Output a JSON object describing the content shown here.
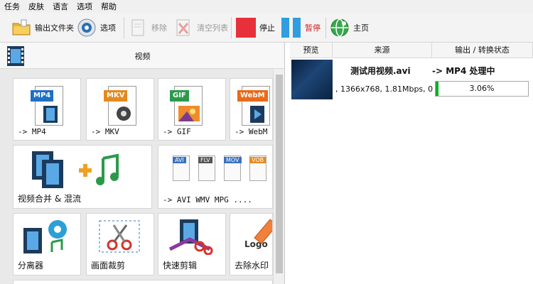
{
  "menu": [
    "任务",
    "皮肤",
    "语言",
    "选项",
    "帮助"
  ],
  "toolbar": {
    "output_folder": "输出文件夹",
    "options": "选项",
    "remove": "移除",
    "clear_list": "清空列表",
    "stop": "停止",
    "pause": "暂停",
    "home": "主页"
  },
  "category": {
    "label": "视频"
  },
  "tiles": {
    "mp4": {
      "tag": "MP4",
      "label": "-> MP4"
    },
    "mkv": {
      "tag": "MKV",
      "label": "-> MKV"
    },
    "gif": {
      "tag": "GIF",
      "label": "-> GIF"
    },
    "webm": {
      "tag": "WebM",
      "label": "-> WebM"
    },
    "merge": {
      "label": "视频合并 & 混流"
    },
    "multi": {
      "tags": [
        "AVI",
        "FLV",
        "MOV",
        "VOB"
      ],
      "label": "-> AVI WMV MPG ...."
    },
    "splitter": {
      "label": "分离器"
    },
    "crop": {
      "label": "画面裁剪"
    },
    "quickcut": {
      "label": "快速剪辑"
    },
    "watermark": {
      "logo": "Logo",
      "label": "去除水印"
    }
  },
  "tasklist": {
    "headers": {
      "preview": "预览",
      "source": "来源",
      "output": "输出 / 转换状态"
    },
    "row": {
      "filename": "测试用视频.avi",
      "info": ", 1366x768, 1.81Mbps, 0",
      "status": "-> MP4 处理中",
      "progress_text": "3.06%",
      "progress": 0.0306
    }
  },
  "colors": {
    "stop": "#e8303a",
    "pause": "#2f9de0",
    "progress": "#06b025",
    "mp4_tag": "#1f6fc4",
    "mkv_tag": "#e58a1f",
    "gif_tag": "#2a9a4a",
    "webm_tag": "#e86a1a"
  }
}
